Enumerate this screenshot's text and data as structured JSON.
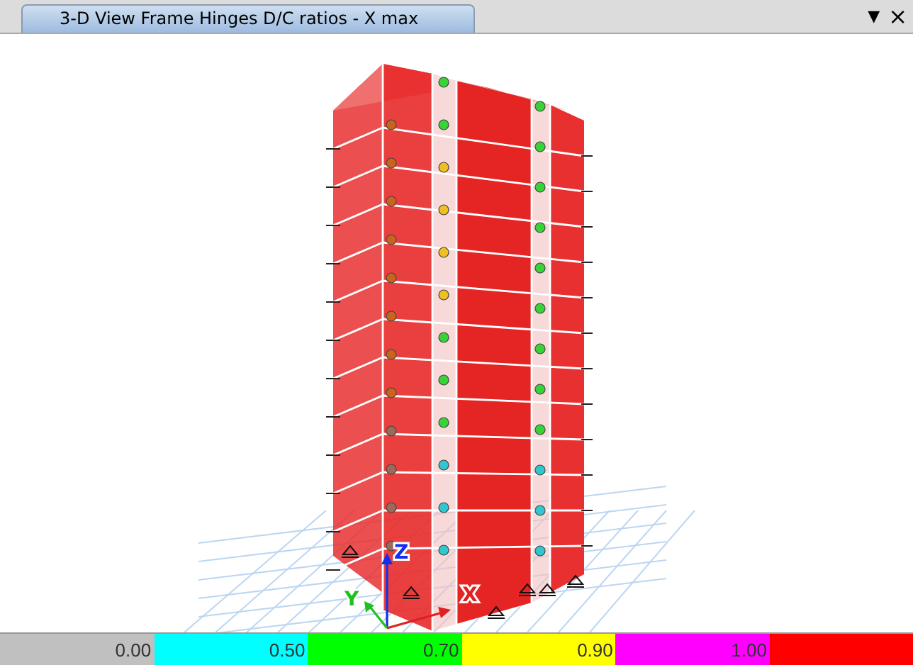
{
  "tab": {
    "title": "3-D View  Frame Hinges D/C ratios - X max",
    "selected": true
  },
  "window_controls": {
    "menu": "▼",
    "close": "×"
  },
  "axes": {
    "x": "X",
    "y": "Y",
    "z": "Z"
  },
  "legend": [
    {
      "label": "0.00",
      "color": "#c0c0c0"
    },
    {
      "label": "0.50",
      "color": "#00ffff"
    },
    {
      "label": "0.70",
      "color": "#00ff00"
    },
    {
      "label": "0.90",
      "color": "#ffff00"
    },
    {
      "label": "1.00",
      "color": "#ff00ff"
    },
    {
      "color": "#ff0000"
    }
  ]
}
